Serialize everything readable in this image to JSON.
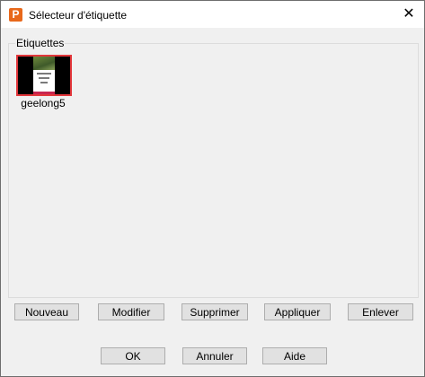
{
  "window": {
    "title": "Sélecteur d'étiquette",
    "app_icon_letter": "P",
    "close_glyph": "✕"
  },
  "labels_group": {
    "label": "Etiquettes",
    "items": [
      {
        "name": "geelong5"
      }
    ]
  },
  "buttons": {
    "row1": [
      "Nouveau",
      "Modifier",
      "Supprimer",
      "Appliquer",
      "Enlever"
    ],
    "row2": [
      "OK",
      "Annuler",
      "Aide"
    ]
  },
  "colors": {
    "selection_border": "#e2373b",
    "app_icon": "#e8681b"
  }
}
